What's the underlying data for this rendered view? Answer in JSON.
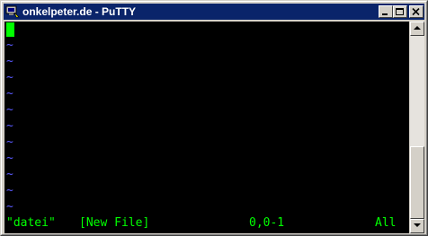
{
  "window": {
    "title": "onkelpeter.de - PuTTY"
  },
  "titlebar_buttons": {
    "minimize": "minimize-icon",
    "maximize": "maximize-icon",
    "close": "close-icon"
  },
  "editor": {
    "empty_line_marker": "~",
    "status": {
      "filename": "\"datei\"",
      "flag": "[New File]",
      "position": "0,0-1",
      "scroll": "All"
    }
  },
  "colors": {
    "titlebar": "#0a246a",
    "terminal_bg": "#000000",
    "text": "#00ff00",
    "tilde": "#5a5aff"
  }
}
